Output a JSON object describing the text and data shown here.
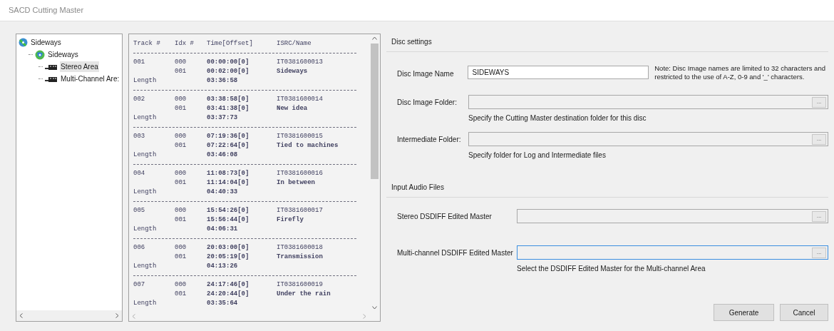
{
  "window": {
    "title": "SACD Cutting Master"
  },
  "tree": [
    {
      "label": "Sideways",
      "kind": "disc",
      "selected": false,
      "children": [
        {
          "label": "Sideways",
          "kind": "album",
          "selected": false,
          "children": [
            {
              "label": "Stereo Area",
              "kind": "area",
              "selected": true
            },
            {
              "label": "Multi-Channel Are:",
              "kind": "area",
              "selected": false
            }
          ]
        }
      ]
    }
  ],
  "track_list": {
    "columns": [
      "Track #",
      "Idx #",
      "Time[Offset]",
      "ISRC/Name"
    ],
    "tracks": [
      {
        "track": "001",
        "indexes": [
          {
            "idx": "000",
            "time": "00:00:00[0]",
            "info": "IT0381600013"
          },
          {
            "idx": "001",
            "time": "00:02:00[0]",
            "info": "Sideways"
          }
        ],
        "length_label": "Length",
        "length": "03:36:58"
      },
      {
        "track": "002",
        "indexes": [
          {
            "idx": "000",
            "time": "03:38:58[0]",
            "info": "IT0381600014"
          },
          {
            "idx": "001",
            "time": "03:41:38[0]",
            "info": "New idea"
          }
        ],
        "length_label": "Length",
        "length": "03:37:73"
      },
      {
        "track": "003",
        "indexes": [
          {
            "idx": "000",
            "time": "07:19:36[0]",
            "info": "IT0381600015"
          },
          {
            "idx": "001",
            "time": "07:22:64[0]",
            "info": "Tied to machines"
          }
        ],
        "length_label": "Length",
        "length": "03:46:08"
      },
      {
        "track": "004",
        "indexes": [
          {
            "idx": "000",
            "time": "11:08:73[0]",
            "info": "IT0381600016"
          },
          {
            "idx": "001",
            "time": "11:14:04[0]",
            "info": "In between"
          }
        ],
        "length_label": "Length",
        "length": "04:40:33"
      },
      {
        "track": "005",
        "indexes": [
          {
            "idx": "000",
            "time": "15:54:26[0]",
            "info": "IT0381600017"
          },
          {
            "idx": "001",
            "time": "15:56:44[0]",
            "info": "Firefly"
          }
        ],
        "length_label": "Length",
        "length": "04:06:31"
      },
      {
        "track": "006",
        "indexes": [
          {
            "idx": "000",
            "time": "20:03:00[0]",
            "info": "IT0381600018"
          },
          {
            "idx": "001",
            "time": "20:05:19[0]",
            "info": "Transmission"
          }
        ],
        "length_label": "Length",
        "length": "04:13:26"
      },
      {
        "track": "007",
        "indexes": [
          {
            "idx": "000",
            "time": "24:17:46[0]",
            "info": "IT0381600019"
          },
          {
            "idx": "001",
            "time": "24:20:44[0]",
            "info": "Under the rain"
          }
        ],
        "length_label": "Length",
        "length": "03:35:64"
      }
    ]
  },
  "disc_settings": {
    "title": "Disc settings",
    "name": {
      "label": "Disc Image Name",
      "value": "SIDEWAYS",
      "note": "Note: Disc Image names are limited to 32 characters and restricted to the use of A-Z, 0-9 and '_' characters."
    },
    "folders": [
      {
        "label": "Disc Image Folder:",
        "button": "...",
        "hint": "Specify the Cutting Master destination folder for this disc",
        "focused": false
      },
      {
        "label": "Intermediate Folder:",
        "button": "...",
        "hint": "Specify folder for Log and Intermediate files",
        "focused": false
      }
    ]
  },
  "input_audio_files": {
    "title": "Input Audio Files",
    "files": [
      {
        "label": "Stereo DSDIFF Edited Master",
        "button": "...",
        "focused": false
      },
      {
        "label": "Multi-channel DSDIFF Edited Master",
        "button": "...",
        "hint": "Select the DSDIFF Edited Master for the Multi-channel Area",
        "focused": true
      }
    ]
  },
  "buttons": [
    "Generate",
    "Cancel"
  ]
}
